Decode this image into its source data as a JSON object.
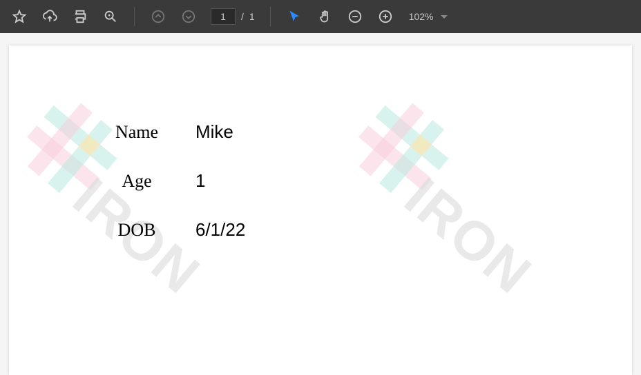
{
  "toolbar": {
    "page_current": "1",
    "page_sep": "/",
    "page_total": "1",
    "zoom": "102%"
  },
  "document": {
    "labels": {
      "name": "Name",
      "age": "Age",
      "dob": "DOB"
    },
    "values": {
      "name": "Mike",
      "age": "1",
      "dob": "6/1/22"
    },
    "watermark_text": "IRON"
  }
}
